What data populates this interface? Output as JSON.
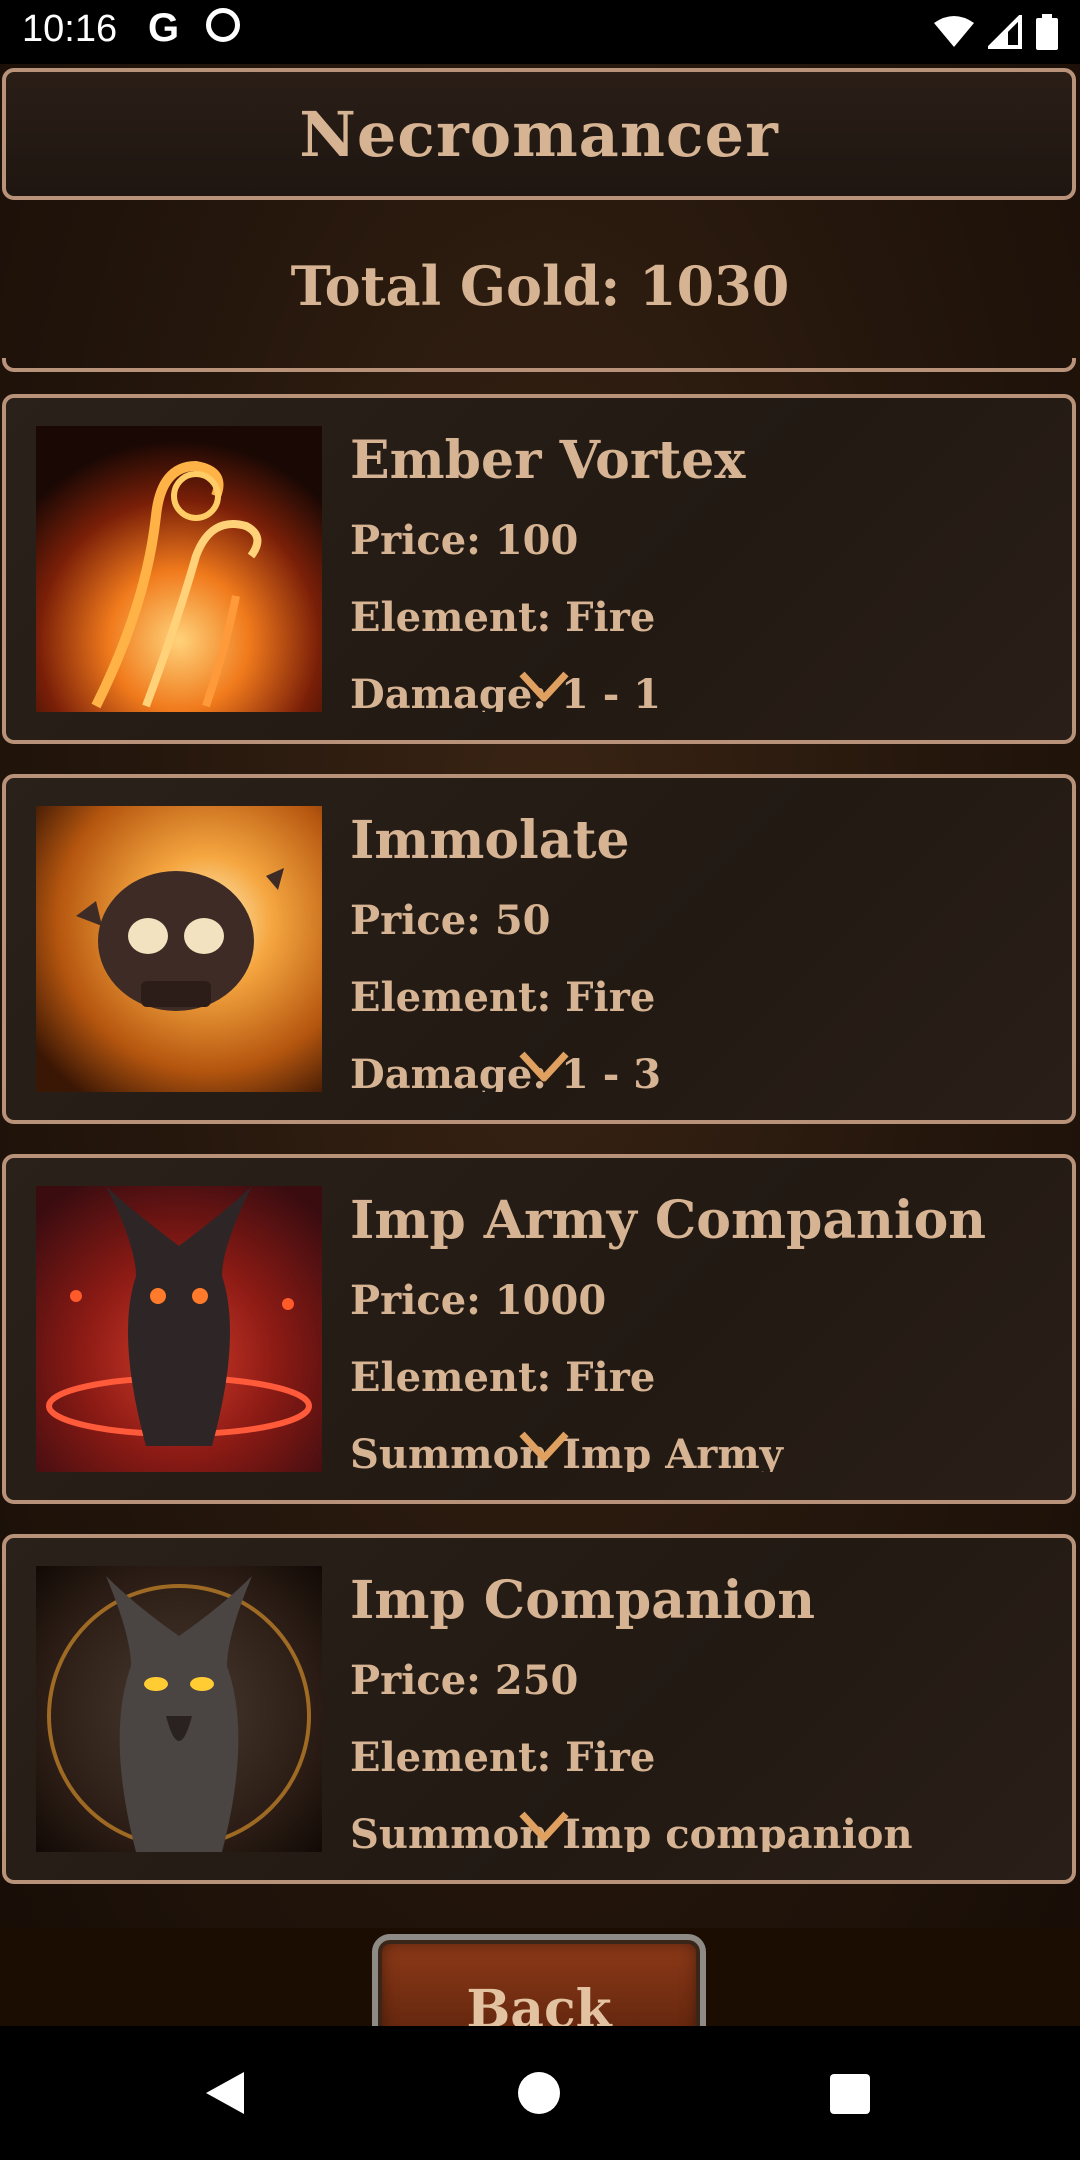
{
  "status_bar": {
    "time": "10:16",
    "icons": [
      "google-g-icon",
      "circle-q-icon",
      "wifi-icon",
      "signal-icon",
      "battery-icon"
    ]
  },
  "header": {
    "title": "Necromancer"
  },
  "gold": {
    "label": "Total Gold: 1030"
  },
  "items": [
    {
      "name": "Ember Vortex",
      "price": "Price: 100",
      "element": "Element: Fire",
      "detail": "Damage: 1 - 1",
      "icon": "ember-vortex-image"
    },
    {
      "name": "Immolate",
      "price": "Price: 50",
      "element": "Element: Fire",
      "detail": "Damage: 1 - 3",
      "icon": "immolate-skull-image"
    },
    {
      "name": "Imp Army Companion",
      "price": "Price: 1000",
      "element": "Element: Fire",
      "detail": "Summon Imp Army",
      "icon": "imp-army-image"
    },
    {
      "name": "Imp Companion",
      "price": "Price: 250",
      "element": "Element: Fire",
      "detail": "Summon Imp companion",
      "icon": "imp-companion-image"
    }
  ],
  "footer": {
    "back_label": "Back"
  },
  "nav": {
    "icons": [
      "back-triangle-icon",
      "home-circle-icon",
      "recents-square-icon"
    ]
  },
  "colors": {
    "text": "#d6b392",
    "border": "#b8937a",
    "background": "#24160c"
  }
}
